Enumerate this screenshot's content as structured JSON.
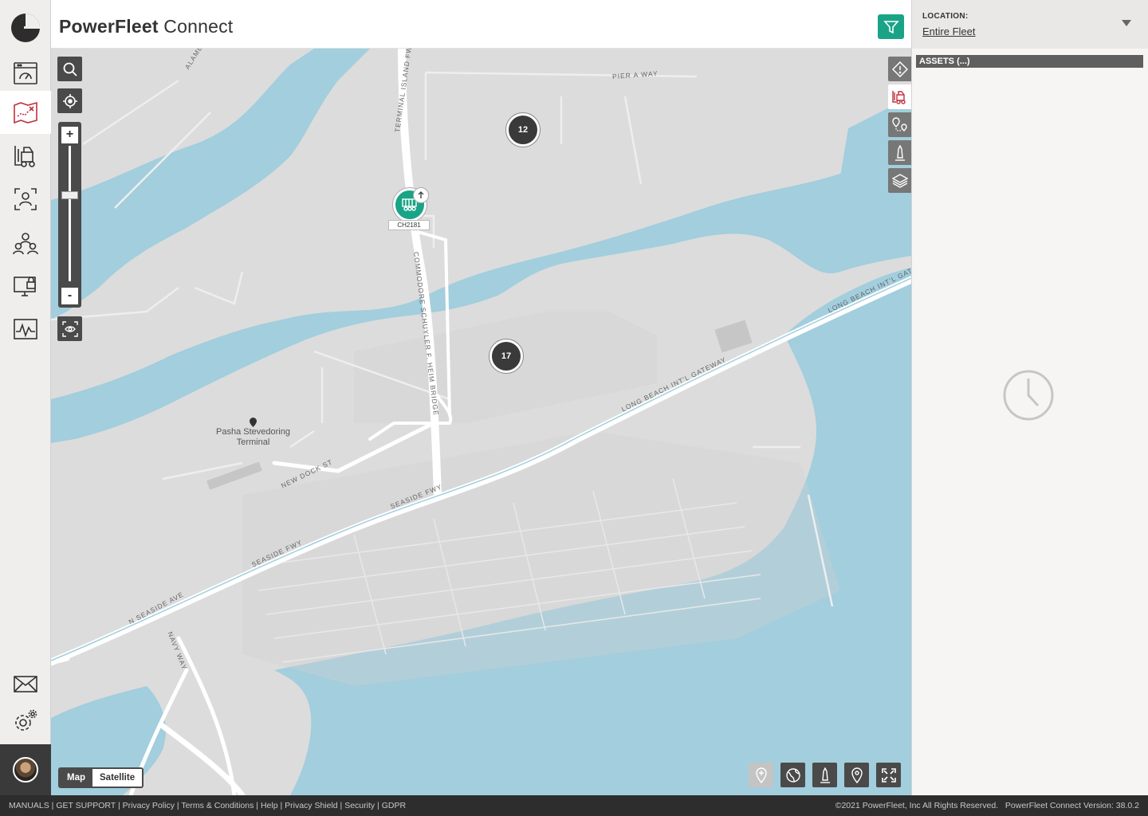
{
  "app": {
    "brand_bold": "PowerFleet",
    "brand_light": " Connect"
  },
  "nav": {
    "items": [
      {
        "name": "dashboard",
        "icon": "dashboard-icon"
      },
      {
        "name": "map",
        "icon": "map-icon",
        "active": true
      },
      {
        "name": "assets",
        "icon": "forklift-icon"
      },
      {
        "name": "users",
        "icon": "user-scan-icon"
      },
      {
        "name": "groups",
        "icon": "group-icon"
      },
      {
        "name": "access",
        "icon": "monitor-lock-icon"
      },
      {
        "name": "analytics",
        "icon": "analytics-icon"
      }
    ],
    "bottom": [
      {
        "name": "messages",
        "icon": "envelope-icon"
      },
      {
        "name": "settings",
        "icon": "gear-icon"
      }
    ]
  },
  "location": {
    "label": "LOCATION:",
    "value": "Entire Fleet"
  },
  "assets_panel": {
    "title": "ASSETS (...)"
  },
  "map": {
    "clusters": [
      {
        "count": "12"
      },
      {
        "count": "17"
      }
    ],
    "vehicle": {
      "id": "CH2181"
    },
    "labels": {
      "pier_a_way": "PIER A WAY",
      "terminal_island_fwy": "TERMINAL ISLAND FWY",
      "commodore": "COMMODORE SCHUYLER F. HEIM BRIDGE",
      "long_beach_1": "LONG BEACH INT'L GATEWAY",
      "long_beach_2": "LONG BEACH INT'L GATE",
      "new_dock": "NEW DOCK ST",
      "seaside_1": "SEASIDE FWY",
      "seaside_2": "SEASIDE FWY",
      "n_seaside": "N SEASIDE AVE",
      "navy_way": "NAVY WAY",
      "alameda": "ALAME"
    },
    "poi": {
      "line1": "Pasha Stevedoring",
      "line2": "Terminal"
    },
    "type_toggle": {
      "map": "Map",
      "satellite": "Satellite",
      "selected": "Map"
    }
  },
  "footer": {
    "links": [
      "MANUALS",
      "GET SUPPORT",
      "Privacy Policy",
      "Terms & Conditions",
      "Help",
      "Privacy Shield",
      "Security",
      "GDPR"
    ],
    "copyright": "©2021 PowerFleet, Inc  All Rights Reserved.",
    "version": "PowerFleet Connect Version: 38.0.2"
  },
  "colors": {
    "accent": "#1aa487",
    "water": "#a2cedd",
    "land": "#dcdcdc",
    "control": "#4a4a4a"
  }
}
